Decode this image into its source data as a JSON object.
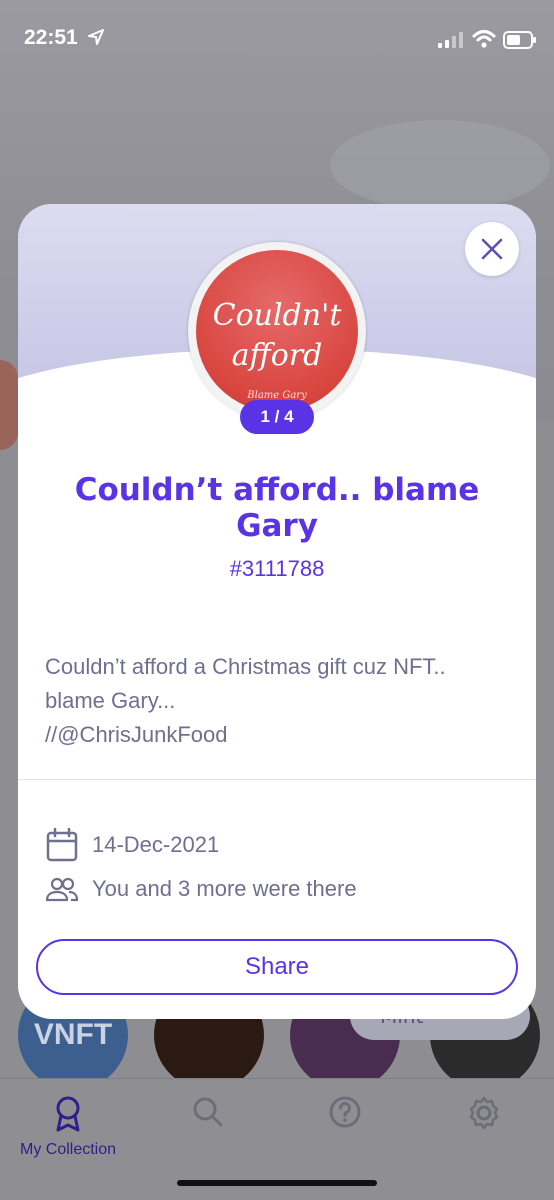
{
  "status_bar": {
    "time": "22:51"
  },
  "modal": {
    "counter": "1 / 4",
    "badge_text": {
      "line1": "Couldn't",
      "line2": "afford",
      "sign": "Blame Gary"
    },
    "title": "Couldn’t afford.. blame Gary",
    "id": "#3111788",
    "description": "Couldn’t afford a Christmas gift cuz NFT..\nblame Gary...\n//@ChrisJunkFood",
    "date": "14-Dec-2021",
    "attendance": "You and 3 more were there",
    "share_label": "Share"
  },
  "background": {
    "nft_1_label": "VNFT",
    "mint_label": "Mint"
  },
  "tab_bar": {
    "items": [
      {
        "label": "My Collection",
        "icon": "award-icon",
        "active": true
      },
      {
        "label": "",
        "icon": "search-icon"
      },
      {
        "label": "",
        "icon": "help-icon"
      },
      {
        "label": "",
        "icon": "gear-icon"
      }
    ]
  },
  "colors": {
    "accent": "#5b33e6",
    "text_muted": "#6f6f92",
    "badge_red": "#d9453f"
  }
}
